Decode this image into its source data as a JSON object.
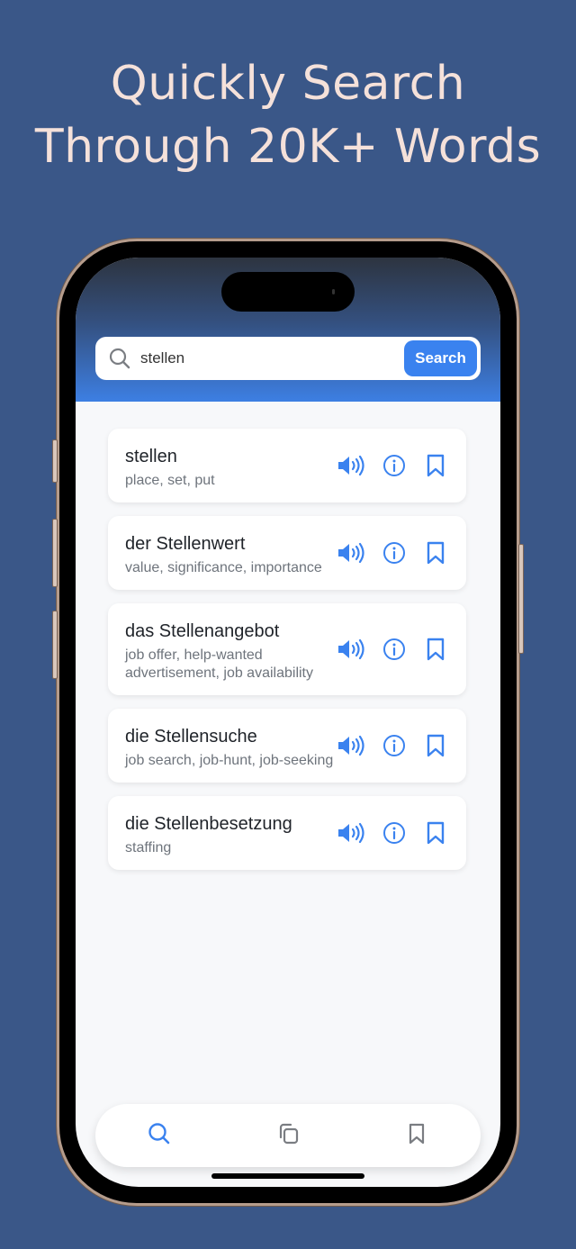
{
  "headline": {
    "line1": "Quickly Search",
    "line2": "Through 20K+ Words"
  },
  "search": {
    "value": "stellen",
    "button_label": "Search",
    "icon": "search-icon"
  },
  "results": [
    {
      "word": "stellen",
      "meaning": "place, set, put"
    },
    {
      "word": "der Stellenwert",
      "meaning": "value, significance, importance"
    },
    {
      "word": "das Stellenangebot",
      "meaning": "job offer, help-wanted advertisement, job availability"
    },
    {
      "word": "die Stellensuche",
      "meaning": "job search, job-hunt, job-seeking"
    },
    {
      "word": "die Stellenbesetzung",
      "meaning": "staffing"
    }
  ],
  "result_actions": [
    "speaker-icon",
    "info-icon",
    "bookmark-icon"
  ],
  "tabbar": {
    "tabs": [
      {
        "name": "search",
        "icon": "search-icon",
        "active": true
      },
      {
        "name": "flashcards",
        "icon": "copy-icon",
        "active": false
      },
      {
        "name": "bookmarks",
        "icon": "bookmark-icon",
        "active": false
      }
    ]
  },
  "colors": {
    "background": "#3a5788",
    "headline": "#f5e1da",
    "accent": "#3a82ef",
    "inactive_icon": "#7a7d82"
  }
}
